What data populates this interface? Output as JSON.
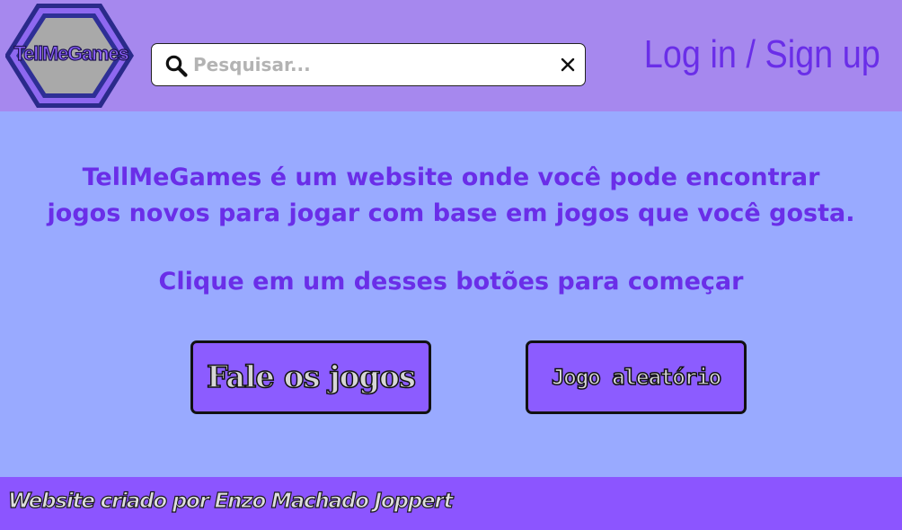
{
  "header": {
    "logo_text": "TellMeGames",
    "search": {
      "placeholder": "Pesquisar...",
      "value": ""
    },
    "login_label": "Log in / Sign up"
  },
  "main": {
    "intro_line_1": "TellMeGames é um website onde você pode encontrar",
    "intro_line_2": "jogos novos para jogar com base em jogos que você gosta.",
    "prompt": "Clique em um desses botões para começar",
    "buttons": [
      {
        "label": "Fale os jogos"
      },
      {
        "label": "Jogo aleatório"
      }
    ]
  },
  "footer": {
    "credit": "Website criado por Enzo Machado Joppert"
  },
  "icons": {
    "search": "search-icon",
    "clear": "close-icon"
  },
  "colors": {
    "header_bg": "#a688ee",
    "page_bg": "#99aaff",
    "accent_text": "#6a2ee8",
    "button_bg": "#8c5cff",
    "footer_bg": "#8c55ff"
  }
}
